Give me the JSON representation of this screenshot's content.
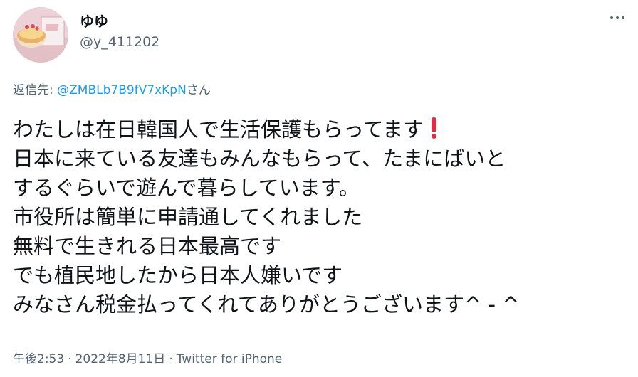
{
  "author": {
    "display_name": "ゆゆ",
    "username": "@y_411202"
  },
  "more_icon": "more-horizontal-icon",
  "reply": {
    "prefix": "返信先: ",
    "mention": "@ZMBLb7B9fV7xKpN",
    "suffix": "さん"
  },
  "tweet": {
    "lines": [
      "わたしは在日韓国人で生活保護もらってます",
      "日本に来ている友達もみんなもらって、たまにばいと",
      "するぐらいで遊んで暮らしています。",
      "市役所は簡単に申請通してくれました",
      "無料で生きれる日本最高です",
      "でも植民地したから日本人嫌いです",
      "みなさん税金払ってくれてありがとうございます^ - ^"
    ],
    "emoji": "exclamation-mark-icon"
  },
  "meta": {
    "time": "午後2:53",
    "separator": "·",
    "date": "2022年8月11日",
    "source": "Twitter for iPhone"
  },
  "colors": {
    "text": "#0f1419",
    "secondary": "#536471",
    "link": "#1d9bf0",
    "emoji_red": "#dd2e44"
  }
}
